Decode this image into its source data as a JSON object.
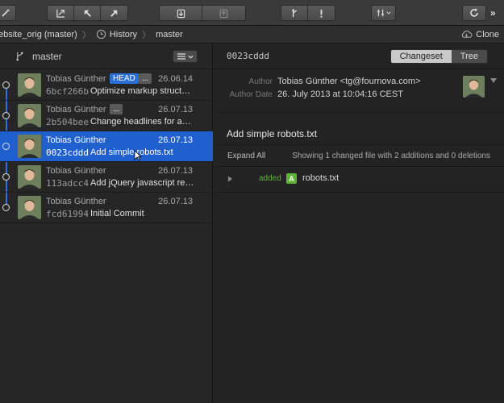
{
  "breadcrumb": {
    "repo": "ebsite_orig (master)",
    "history": "History",
    "branch": "master",
    "clone": "Clone"
  },
  "sidebar": {
    "branch_label": "master"
  },
  "commits": [
    {
      "author": "Tobias Günther",
      "date": "26.06.14",
      "hash": "6bcf266b",
      "message": "Optimize markup structur…",
      "badge": "HEAD",
      "extra_badge": "..."
    },
    {
      "author": "Tobias Günther",
      "date": "26.07.13",
      "hash": "2b504bee",
      "message": "Change headlines for abo…",
      "extra_badge": "..."
    },
    {
      "author": "Tobias Günther",
      "date": "26.07.13",
      "hash": "0023cddd",
      "message": "Add simple robots.txt",
      "selected": true
    },
    {
      "author": "Tobias Günther",
      "date": "26.07.13",
      "hash": "113adcc4",
      "message": "Add jQuery javascript res…"
    },
    {
      "author": "Tobias Günther",
      "date": "26.07.13",
      "hash": "fcd61994",
      "message": "Initial Commit"
    }
  ],
  "detail": {
    "hash": "0023cddd",
    "tab_changeset": "Changeset",
    "tab_tree": "Tree",
    "author_label": "Author",
    "author_value": "Tobias Günther <tg@fournova.com>",
    "date_label": "Author Date",
    "date_value": "26. July 2013 at 10:04:16 CEST",
    "subject": "Add simple robots.txt",
    "expand_all": "Expand All",
    "summary": "Showing 1 changed file with 2 additions and 0 deletions",
    "files": [
      {
        "status": "added",
        "status_letter": "A",
        "name": "robots.txt"
      }
    ]
  },
  "colors": {
    "selection": "#1f5fce",
    "graph": "#2d6fe0",
    "added": "#5fb236"
  }
}
